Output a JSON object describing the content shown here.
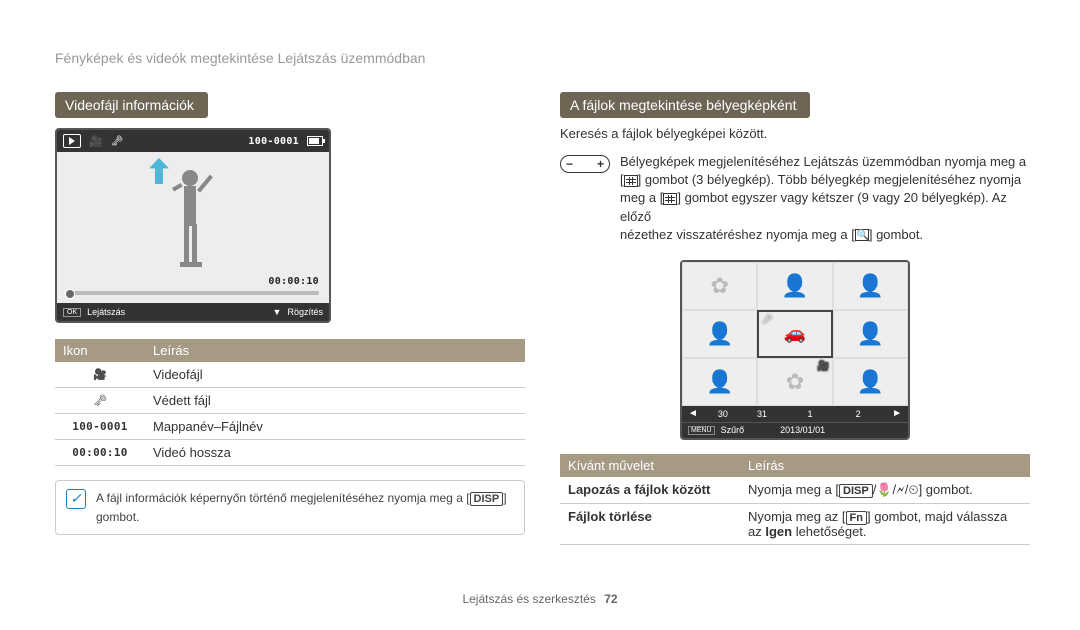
{
  "page_title": "Fényképek és videók megtekintése Lejátszás üzemmódban",
  "footer": {
    "section": "Lejátszás és szerkesztés",
    "page": "72"
  },
  "left": {
    "tab": "Videofájl információk",
    "preview": {
      "folder_file": "100-0001",
      "time_counter": "00:00:10",
      "ok": "OK",
      "play_label": "Lejátszás",
      "down_icon": "▼",
      "capture_label": "Rögzítés"
    },
    "table": {
      "headers": {
        "icon": "Ikon",
        "desc": "Leírás"
      },
      "rows": [
        {
          "icon_name": "camera-icon",
          "icon_glyph": "🎥",
          "desc": "Videofájl"
        },
        {
          "icon_name": "key-icon",
          "icon_glyph": "🗝",
          "desc": "Védett fájl"
        },
        {
          "icon_name": "folder-file-label",
          "icon_text": "100-0001",
          "desc": "Mappanév–Fájlnév"
        },
        {
          "icon_name": "duration-label",
          "icon_text": "00:00:10",
          "desc": "Videó hossza"
        }
      ]
    },
    "note": {
      "before": "A fájl információk képernyőn történő megjelenítéséhez nyomja meg a [",
      "badge": "DISP",
      "after": "] gombot."
    }
  },
  "right": {
    "tab": "A fájlok megtekintése bélyegképként",
    "desc": "Keresés a fájlok bélyegképei között.",
    "zoom_instruction": {
      "l1": "Bélyegképek megjelenítéséhez Lejátszás üzemmódban nyomja meg a",
      "l2a": "[",
      "l2b": "] gombot (3 bélyegkép). Több bélyegkép megjelenítéséhez nyomja",
      "l3a": "meg a [",
      "l3b": "] gombot egyszer vagy kétszer (9 vagy 20 bélyegkép). Az előző",
      "l4a": "nézethez visszatéréshez nyomja meg a [",
      "l4b": "] gombot."
    },
    "thumb_bar": {
      "nav_left": "◄",
      "nav_right": "►",
      "nums": [
        "30",
        "31",
        "1",
        "2"
      ],
      "menu": "MENU",
      "filter": "Szűrő",
      "date": "2013/01/01"
    },
    "op_table": {
      "headers": {
        "op": "Kívánt művelet",
        "desc": "Leírás"
      },
      "rows": [
        {
          "op": "Lapozás a fájlok között",
          "desc_before": "Nyomja meg a [",
          "badge": "DISP",
          "desc_mid": "/🌷/🗲/⏲",
          "desc_after": "] gombot."
        },
        {
          "op": "Fájlok törlése",
          "desc_before": "Nyomja meg az [",
          "badge": "Fn",
          "desc_mid": "] gombot, majd válassza az ",
          "bold": "Igen",
          "desc_after": " lehetőséget."
        }
      ]
    }
  }
}
